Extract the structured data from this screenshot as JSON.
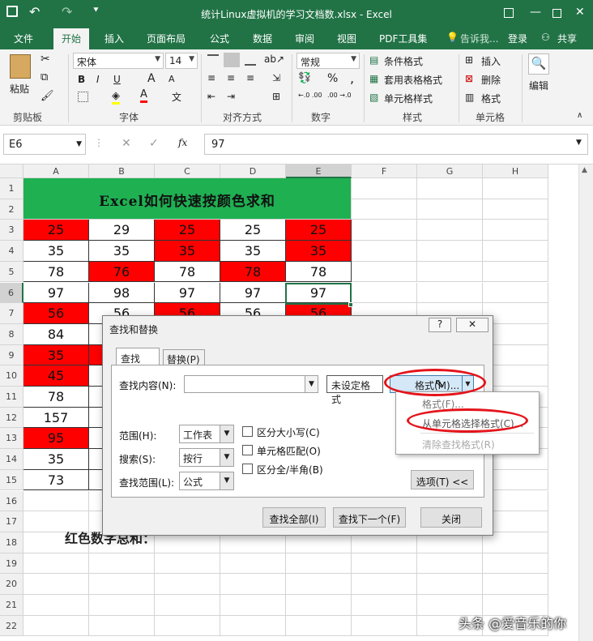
{
  "window": {
    "title": "统计Linux虚拟机的学习文档数.xlsx - Excel"
  },
  "tabs": [
    "文件",
    "开始",
    "插入",
    "页面布局",
    "公式",
    "数据",
    "审阅",
    "视图",
    "PDF工具集",
    "告诉我...",
    "登录",
    "共享"
  ],
  "ribbon": {
    "clipboard": {
      "paste": "粘贴",
      "label": "剪贴板"
    },
    "font": {
      "name": "宋体",
      "size": "14",
      "bold": "B",
      "italic": "I",
      "underline": "U",
      "label": "字体",
      "grow": "A",
      "shrink": "A"
    },
    "align": {
      "label": "对齐方式"
    },
    "number": {
      "format": "常规",
      "percent": "%",
      "comma": ",",
      "label": "数字",
      "dec1": "←.0 .00",
      "dec2": ".00 →.0"
    },
    "styles": {
      "cond": "条件格式",
      "table": "套用表格格式",
      "cell": "单元格样式",
      "label": "样式"
    },
    "cells": {
      "insert": "插入",
      "delete": "删除",
      "format": "格式",
      "label": "单元格"
    },
    "edit": {
      "label": "编辑"
    }
  },
  "formula": {
    "namebox": "E6",
    "fx": "fx",
    "value": "97"
  },
  "columns": [
    "A",
    "B",
    "C",
    "D",
    "E",
    "F",
    "G",
    "H"
  ],
  "rows": [
    "1",
    "2",
    "3",
    "4",
    "5",
    "6",
    "7",
    "8",
    "9",
    "10",
    "11",
    "12",
    "13",
    "14",
    "15",
    "16",
    "17",
    "18",
    "19",
    "20",
    "21",
    "22"
  ],
  "sheet": {
    "title": "Excel如何快速按颜色求和",
    "r3": [
      "25",
      "29",
      "25",
      "25",
      "25"
    ],
    "r4": [
      "35",
      "35",
      "35",
      "35",
      "35"
    ],
    "r5": [
      "78",
      "76",
      "78",
      "78",
      "78"
    ],
    "r6": [
      "97",
      "98",
      "97",
      "97",
      "97"
    ],
    "r7": [
      "56",
      "56",
      "56",
      "56",
      "56"
    ],
    "colA": [
      "84",
      "35",
      "45",
      "78",
      "157",
      "95",
      "35",
      "73"
    ],
    "note": "红色数字总和："
  },
  "dialog": {
    "title": "查找和替换",
    "help": "?",
    "close": "✕",
    "tab_find": "查找(D)",
    "tab_replace": "替换(P)",
    "find_label": "查找内容(N):",
    "noformat": "未设定格式",
    "format_btn": "格式(M)...",
    "scope_label": "范围(H):",
    "scope_val": "工作表",
    "search_label": "搜索(S):",
    "search_val": "按行",
    "lookin_label": "查找范围(L):",
    "lookin_val": "公式",
    "case": "区分大小写(C)",
    "whole": "单元格匹配(O)",
    "width": "区分全/半角(B)",
    "options": "选项(T) <<",
    "find_all": "查找全部(I)",
    "find_next": "查找下一个(F)",
    "close_btn": "关闭"
  },
  "menu": {
    "item1": "格式(F)...",
    "item2": "从单元格选择格式(C)...",
    "item3": "清除查找格式(R)"
  },
  "watermark": "头条 @爱音乐的你"
}
